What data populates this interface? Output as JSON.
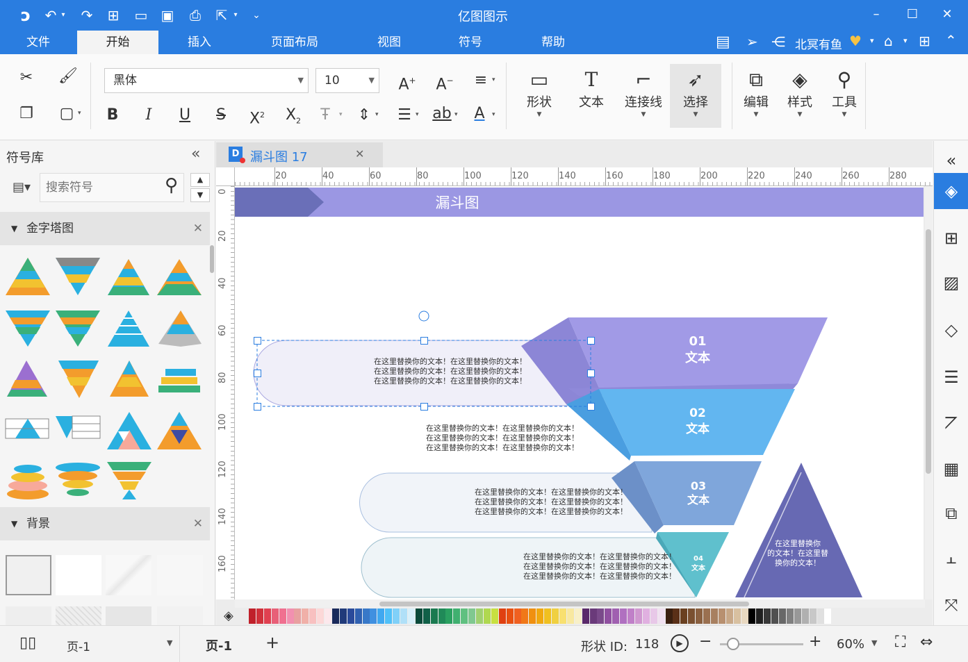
{
  "window": {
    "title": "亿图图示",
    "user": "北冥有鱼"
  },
  "menus": [
    "文件",
    "开始",
    "插入",
    "页面布局",
    "视图",
    "符号",
    "帮助"
  ],
  "active_menu": "开始",
  "ribbon": {
    "font": "黑体",
    "size": "10",
    "big": [
      {
        "label": "形状",
        "icon": "rectangle-icon"
      },
      {
        "label": "文本",
        "icon": "text-icon"
      },
      {
        "label": "连接线",
        "icon": "connector-icon"
      },
      {
        "label": "选择",
        "icon": "pointer-icon"
      },
      {
        "label": "编辑",
        "icon": "edit-icon"
      },
      {
        "label": "样式",
        "icon": "paint-bucket-icon"
      },
      {
        "label": "工具",
        "icon": "tools-icon"
      }
    ]
  },
  "left": {
    "title": "符号库",
    "search_placeholder": "搜索符号",
    "section1": "金字塔图",
    "section2": "背景"
  },
  "tab": {
    "label": "漏斗图 17"
  },
  "ruler_h": [
    "20",
    "40",
    "60",
    "80",
    "100",
    "120",
    "140",
    "160",
    "180",
    "200",
    "220",
    "240",
    "260",
    "280"
  ],
  "ruler_v": [
    "0",
    "20",
    "40",
    "60",
    "80",
    "100",
    "120",
    "140",
    "160"
  ],
  "diagram": {
    "title": "漏斗图",
    "levels": [
      {
        "num": "01",
        "label": "文本",
        "text": "在这里替换你的文本！在这里替换你的文本！\n在这里替换你的文本！在这里替换你的文本！\n在这里替换你的文本！在这里替换你的文本！"
      },
      {
        "num": "02",
        "label": "文本",
        "text": "在这里替换你的文本！在这里替换你的文本！\n在这里替换你的文本！在这里替换你的文本！\n在这里替换你的文本！在这里替换你的文本！"
      },
      {
        "num": "03",
        "label": "文本",
        "text": "在这里替换你的文本！在这里替换你的文本！\n在这里替换你的文本！在这里替换你的文本！\n在这里替换你的文本！在这里替换你的文本！"
      },
      {
        "num": "04",
        "label": "文本",
        "text": "在这里替换你的文本！在这里替换你的文本！\n在这里替换你的文本！在这里替换你的文本！\n在这里替换你的文本！在这里替换你的文本！"
      }
    ],
    "side_text": "在这里替换你\n的文本！在这里替\n换你的文本！"
  },
  "status": {
    "page_select": "页-1",
    "page_tab": "页-1",
    "shape_id_label": "形状 ID:",
    "shape_id": "118",
    "zoom": "60%"
  },
  "colors": {
    "accent": "#2a7de0",
    "title_bar": "#9b97e3",
    "level1": "#a19ae6",
    "level2": "#62b6f0",
    "level3": "#7fa6db",
    "level4": "#5fc0cd",
    "triangle": "#6769b3"
  }
}
